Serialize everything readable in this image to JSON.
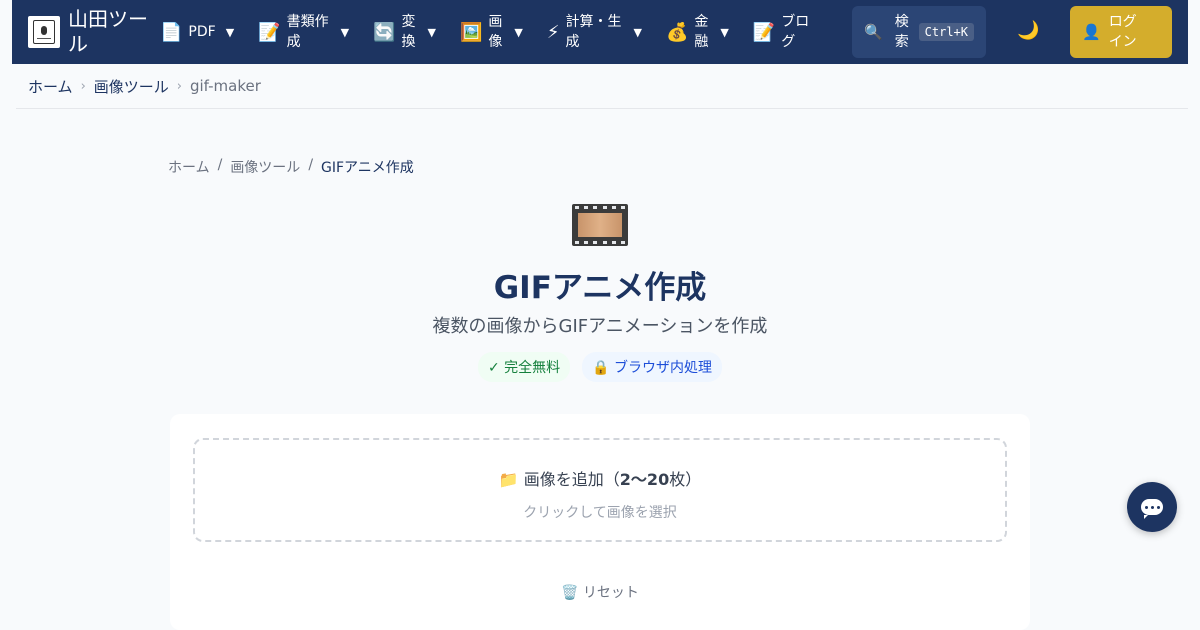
{
  "header": {
    "site_name": "山田ツール",
    "nav": [
      {
        "icon": "📄",
        "icon_name": "pdf-icon",
        "label": "PDF"
      },
      {
        "icon": "📝",
        "icon_name": "memo-icon",
        "label": "書類作成"
      },
      {
        "icon": "🔄",
        "icon_name": "convert-icon",
        "label": "変換"
      },
      {
        "icon": "🖼️",
        "icon_name": "image-icon",
        "label": "画像"
      },
      {
        "icon": "⚡",
        "icon_name": "lightning-icon",
        "label": "計算・生成"
      },
      {
        "icon": "💰",
        "icon_name": "money-bag-icon",
        "label": "金融"
      },
      {
        "icon": "📝",
        "icon_name": "memo-icon",
        "label": "ブログ"
      }
    ],
    "dropdown_arrow": "▼",
    "search_label": "検索",
    "search_shortcut": "Ctrl+K",
    "login_label": "ログイン"
  },
  "breadcrumb": {
    "items": [
      "ホーム",
      "画像ツール",
      "gif-maker"
    ],
    "separator": "›"
  },
  "page_breadcrumb": {
    "items": [
      "ホーム",
      "画像ツール",
      "GIFアニメ作成"
    ],
    "separator": "/"
  },
  "main": {
    "title": "GIFアニメ作成",
    "subtitle": "複数の画像からGIFアニメーションを作成",
    "badges": [
      "✓ 完全無料",
      "🔒 ブラウザ内処理"
    ]
  },
  "uploader": {
    "title_prefix": "📁 画像を追加（",
    "title_count": "2〜20",
    "title_suffix": "枚）",
    "hint": "クリックして画像を選択",
    "reset_label": "🗑️ リセット"
  },
  "colors": {
    "header_bg": "#1d3461",
    "accent": "#d4ad2c"
  }
}
